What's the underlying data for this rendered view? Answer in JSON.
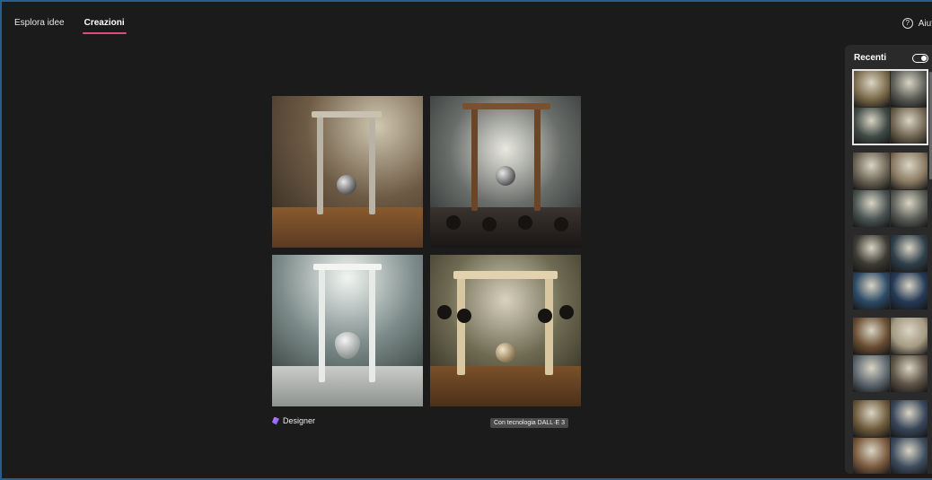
{
  "tabs": [
    {
      "label": "Esplora idee"
    },
    {
      "label": "Creazioni",
      "active": true
    }
  ],
  "help": {
    "label": "Aiut",
    "icon": "question-circle-icon"
  },
  "main": {
    "footer_logo_label": "Designer",
    "footer_logo_icon": "designer-logo-icon",
    "badge": "Con tecnologia DALL·E 3"
  },
  "panel": {
    "title": "Recenti",
    "toggle_state": "on",
    "groups": [
      {
        "colors": [
          "#7a6a4a",
          "#5a5c55",
          "#3f4a45",
          "#6f6450"
        ],
        "selected": true
      },
      {
        "colors": [
          "#6b6353",
          "#8a7a62",
          "#4a5553",
          "#5a5e57"
        ],
        "selected": false
      },
      {
        "colors": [
          "#3b3a33",
          "#2f3f4a",
          "#2c4a66",
          "#253a57"
        ],
        "selected": false
      },
      {
        "colors": [
          "#6b4f33",
          "#a59a82",
          "#5e6870",
          "#5e5346"
        ],
        "selected": false
      },
      {
        "colors": [
          "#6f5b3c",
          "#38465a",
          "#7a5a3e",
          "#3d4c5e"
        ],
        "selected": false
      }
    ]
  }
}
